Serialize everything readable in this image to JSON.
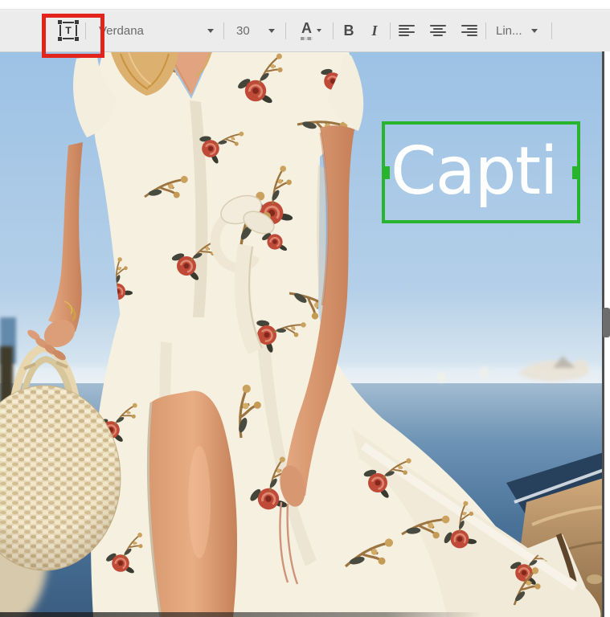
{
  "toolbar": {
    "text_tool_label": "T",
    "text_tool_icon": "text-box-tool-icon",
    "font_family": {
      "value": "Verdana",
      "icon": "caret-down-icon"
    },
    "font_size": {
      "value": "30",
      "icon": "caret-down-icon"
    },
    "text_color_label": "A",
    "bold_label": "B",
    "italic_label": "I",
    "align_icons": [
      "align-left-icon",
      "align-center-icon",
      "align-right-icon"
    ],
    "line_style": {
      "value": "Lin...",
      "icon": "caret-down-icon"
    },
    "colors": {
      "background": "#ececec",
      "label_text": "#6b6b6b",
      "icon": "#4f4f4f"
    }
  },
  "annotation": {
    "purpose": "highlight-text-tool",
    "border_color": "#e2241d"
  },
  "canvas": {
    "caption": {
      "text": "Capti",
      "color": "#ffffff"
    },
    "selection_box": {
      "border_color": "#28b42c",
      "handle_color": "#28b42c"
    },
    "scene": {
      "description_colors": {
        "sky": "#9cc2e5",
        "sea": "#577d9f",
        "dress": "#f6f0e1",
        "skin": "#dfa17c",
        "rose": "#bf4a38",
        "straw_bag": "#e7d8b8",
        "rocks": "#b3906a"
      }
    }
  },
  "scrollbar": {
    "thumb_color": "#6d6d6d"
  }
}
